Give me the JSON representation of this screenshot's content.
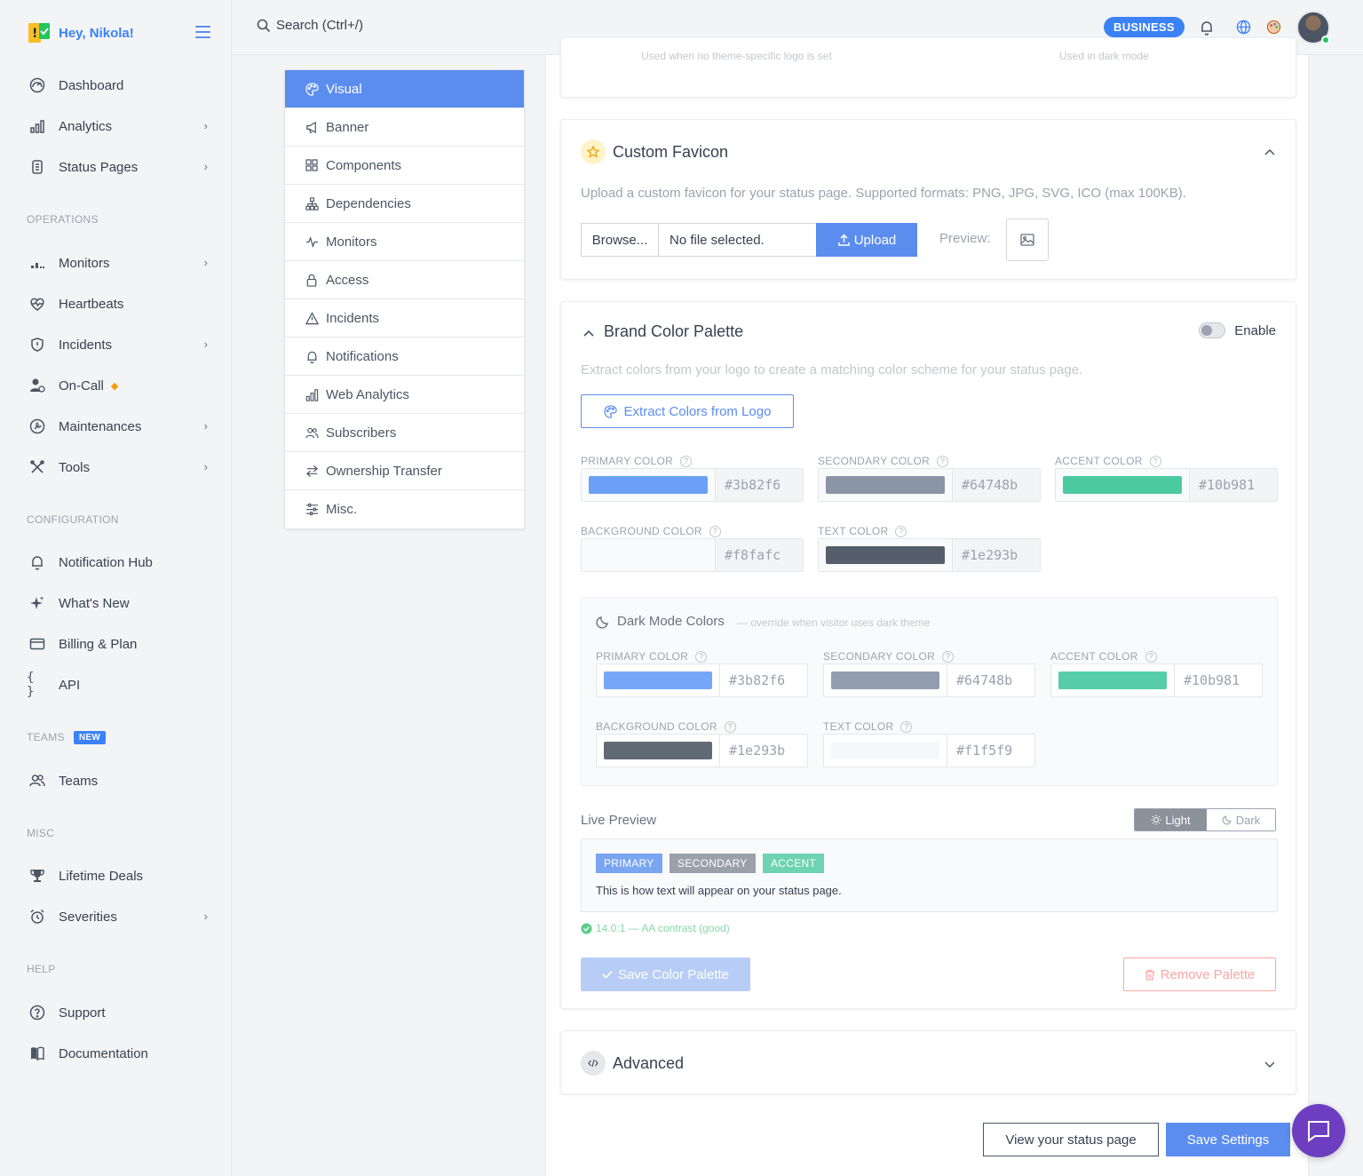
{
  "user": {
    "greeting": "Hey, Nikola!"
  },
  "search": {
    "placeholder": "Search (Ctrl+/)"
  },
  "topbar": {
    "plan_badge": "BUSINESS"
  },
  "sidebar": {
    "primary": [
      {
        "label": "Dashboard"
      },
      {
        "label": "Analytics"
      },
      {
        "label": "Status Pages"
      }
    ],
    "operations_label": "OPERATIONS",
    "operations": [
      {
        "label": "Monitors"
      },
      {
        "label": "Heartbeats"
      },
      {
        "label": "Incidents"
      },
      {
        "label": "On-Call"
      },
      {
        "label": "Maintenances"
      },
      {
        "label": "Tools"
      }
    ],
    "configuration_label": "CONFIGURATION",
    "configuration": [
      {
        "label": "Notification Hub"
      },
      {
        "label": "What's New"
      },
      {
        "label": "Billing & Plan"
      },
      {
        "label": "API"
      }
    ],
    "teams_label": "TEAMS",
    "teams_badge": "NEW",
    "teams": [
      {
        "label": "Teams"
      }
    ],
    "misc_label": "MISC",
    "misc": [
      {
        "label": "Lifetime Deals"
      },
      {
        "label": "Severities"
      }
    ],
    "help_label": "HELP",
    "help": [
      {
        "label": "Support"
      },
      {
        "label": "Documentation"
      }
    ]
  },
  "settings_menu": [
    {
      "label": "Visual",
      "icon": "palette-icon"
    },
    {
      "label": "Banner",
      "icon": "megaphone-icon"
    },
    {
      "label": "Components",
      "icon": "grid-icon"
    },
    {
      "label": "Dependencies",
      "icon": "hierarchy-icon"
    },
    {
      "label": "Monitors",
      "icon": "pulse-icon"
    },
    {
      "label": "Access",
      "icon": "lock-icon"
    },
    {
      "label": "Incidents",
      "icon": "warning-icon"
    },
    {
      "label": "Notifications",
      "icon": "bell-icon"
    },
    {
      "label": "Web Analytics",
      "icon": "bar-chart-icon"
    },
    {
      "label": "Subscribers",
      "icon": "users-icon"
    },
    {
      "label": "Ownership Transfer",
      "icon": "transfer-icon"
    },
    {
      "label": "Misc.",
      "icon": "sliders-icon"
    }
  ],
  "logo_card": {
    "left_hint": "Used when no theme-specific logo is set",
    "right_hint": "Used in dark mode"
  },
  "favicon": {
    "title": "Custom Favicon",
    "description": "Upload a custom favicon for your status page. Supported formats: PNG, JPG, SVG, ICO (max 100KB).",
    "browse": "Browse...",
    "file_name": "No file selected.",
    "upload": "Upload",
    "preview_label": "Preview:"
  },
  "palette": {
    "title": "Brand Color Palette",
    "enable_label": "Enable",
    "description": "Extract colors from your logo to create a matching color scheme for your status page.",
    "extract_button": "Extract Colors from Logo",
    "light": [
      {
        "label": "PRIMARY COLOR",
        "hex": "#3b82f6"
      },
      {
        "label": "SECONDARY COLOR",
        "hex": "#64748b"
      },
      {
        "label": "ACCENT COLOR",
        "hex": "#10b981"
      },
      {
        "label": "BACKGROUND COLOR",
        "hex": "#f8fafc"
      },
      {
        "label": "TEXT COLOR",
        "hex": "#1e293b"
      }
    ],
    "dark_title": "Dark Mode Colors",
    "dark_subtitle": "— override when visitor uses dark theme",
    "dark": [
      {
        "label": "PRIMARY COLOR",
        "hex": "#3b82f6"
      },
      {
        "label": "SECONDARY COLOR",
        "hex": "#64748b"
      },
      {
        "label": "ACCENT COLOR",
        "hex": "#10b981"
      },
      {
        "label": "BACKGROUND COLOR",
        "hex": "#1e293b"
      },
      {
        "label": "TEXT COLOR",
        "hex": "#f1f5f9"
      }
    ],
    "live_preview_label": "Live Preview",
    "mode_light": "Light",
    "mode_dark": "Dark",
    "tag_primary": "PRIMARY",
    "tag_secondary": "SECONDARY",
    "tag_accent": "ACCENT",
    "preview_text": "This is how text will appear on your status page.",
    "contrast": "14.0:1 — AA contrast (good)",
    "save_button": "Save Color Palette",
    "remove_button": "Remove Palette"
  },
  "advanced": {
    "title": "Advanced"
  },
  "footer": {
    "view_button": "View your status page",
    "save_button": "Save Settings"
  },
  "colors": {
    "accent": "#5b8def",
    "success": "#22c55e",
    "danger": "#f87171"
  }
}
